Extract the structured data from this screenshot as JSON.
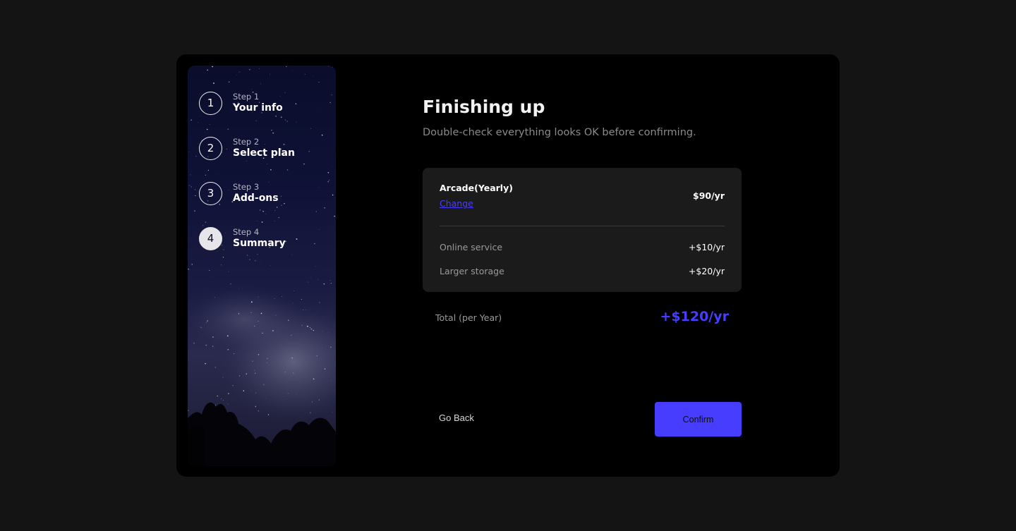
{
  "sidebar": {
    "steps": [
      {
        "number": "1",
        "label": "Step 1",
        "title": "Your info"
      },
      {
        "number": "2",
        "label": "Step 2",
        "title": "Select plan"
      },
      {
        "number": "3",
        "label": "Step 3",
        "title": "Add-ons"
      },
      {
        "number": "4",
        "label": "Step 4",
        "title": "Summary"
      }
    ],
    "active_step": 4
  },
  "main": {
    "title": "Finishing up",
    "subtitle": "Double-check everything looks OK before confirming."
  },
  "summary": {
    "plan_name": "Arcade(Yearly)",
    "change_label": "Change",
    "plan_price": "$90/yr",
    "addons": [
      {
        "name": "Online service",
        "price": "+$10/yr"
      },
      {
        "name": "Larger storage",
        "price": "+$20/yr"
      }
    ],
    "total_label": "Total (per Year)",
    "total_price": "+$120/yr"
  },
  "buttons": {
    "back_label": "Go Back",
    "confirm_label": "Confirm"
  },
  "colors": {
    "background": "#141414",
    "card": "#000000",
    "panel": "#1b1b1b",
    "accent": "#473dff"
  }
}
